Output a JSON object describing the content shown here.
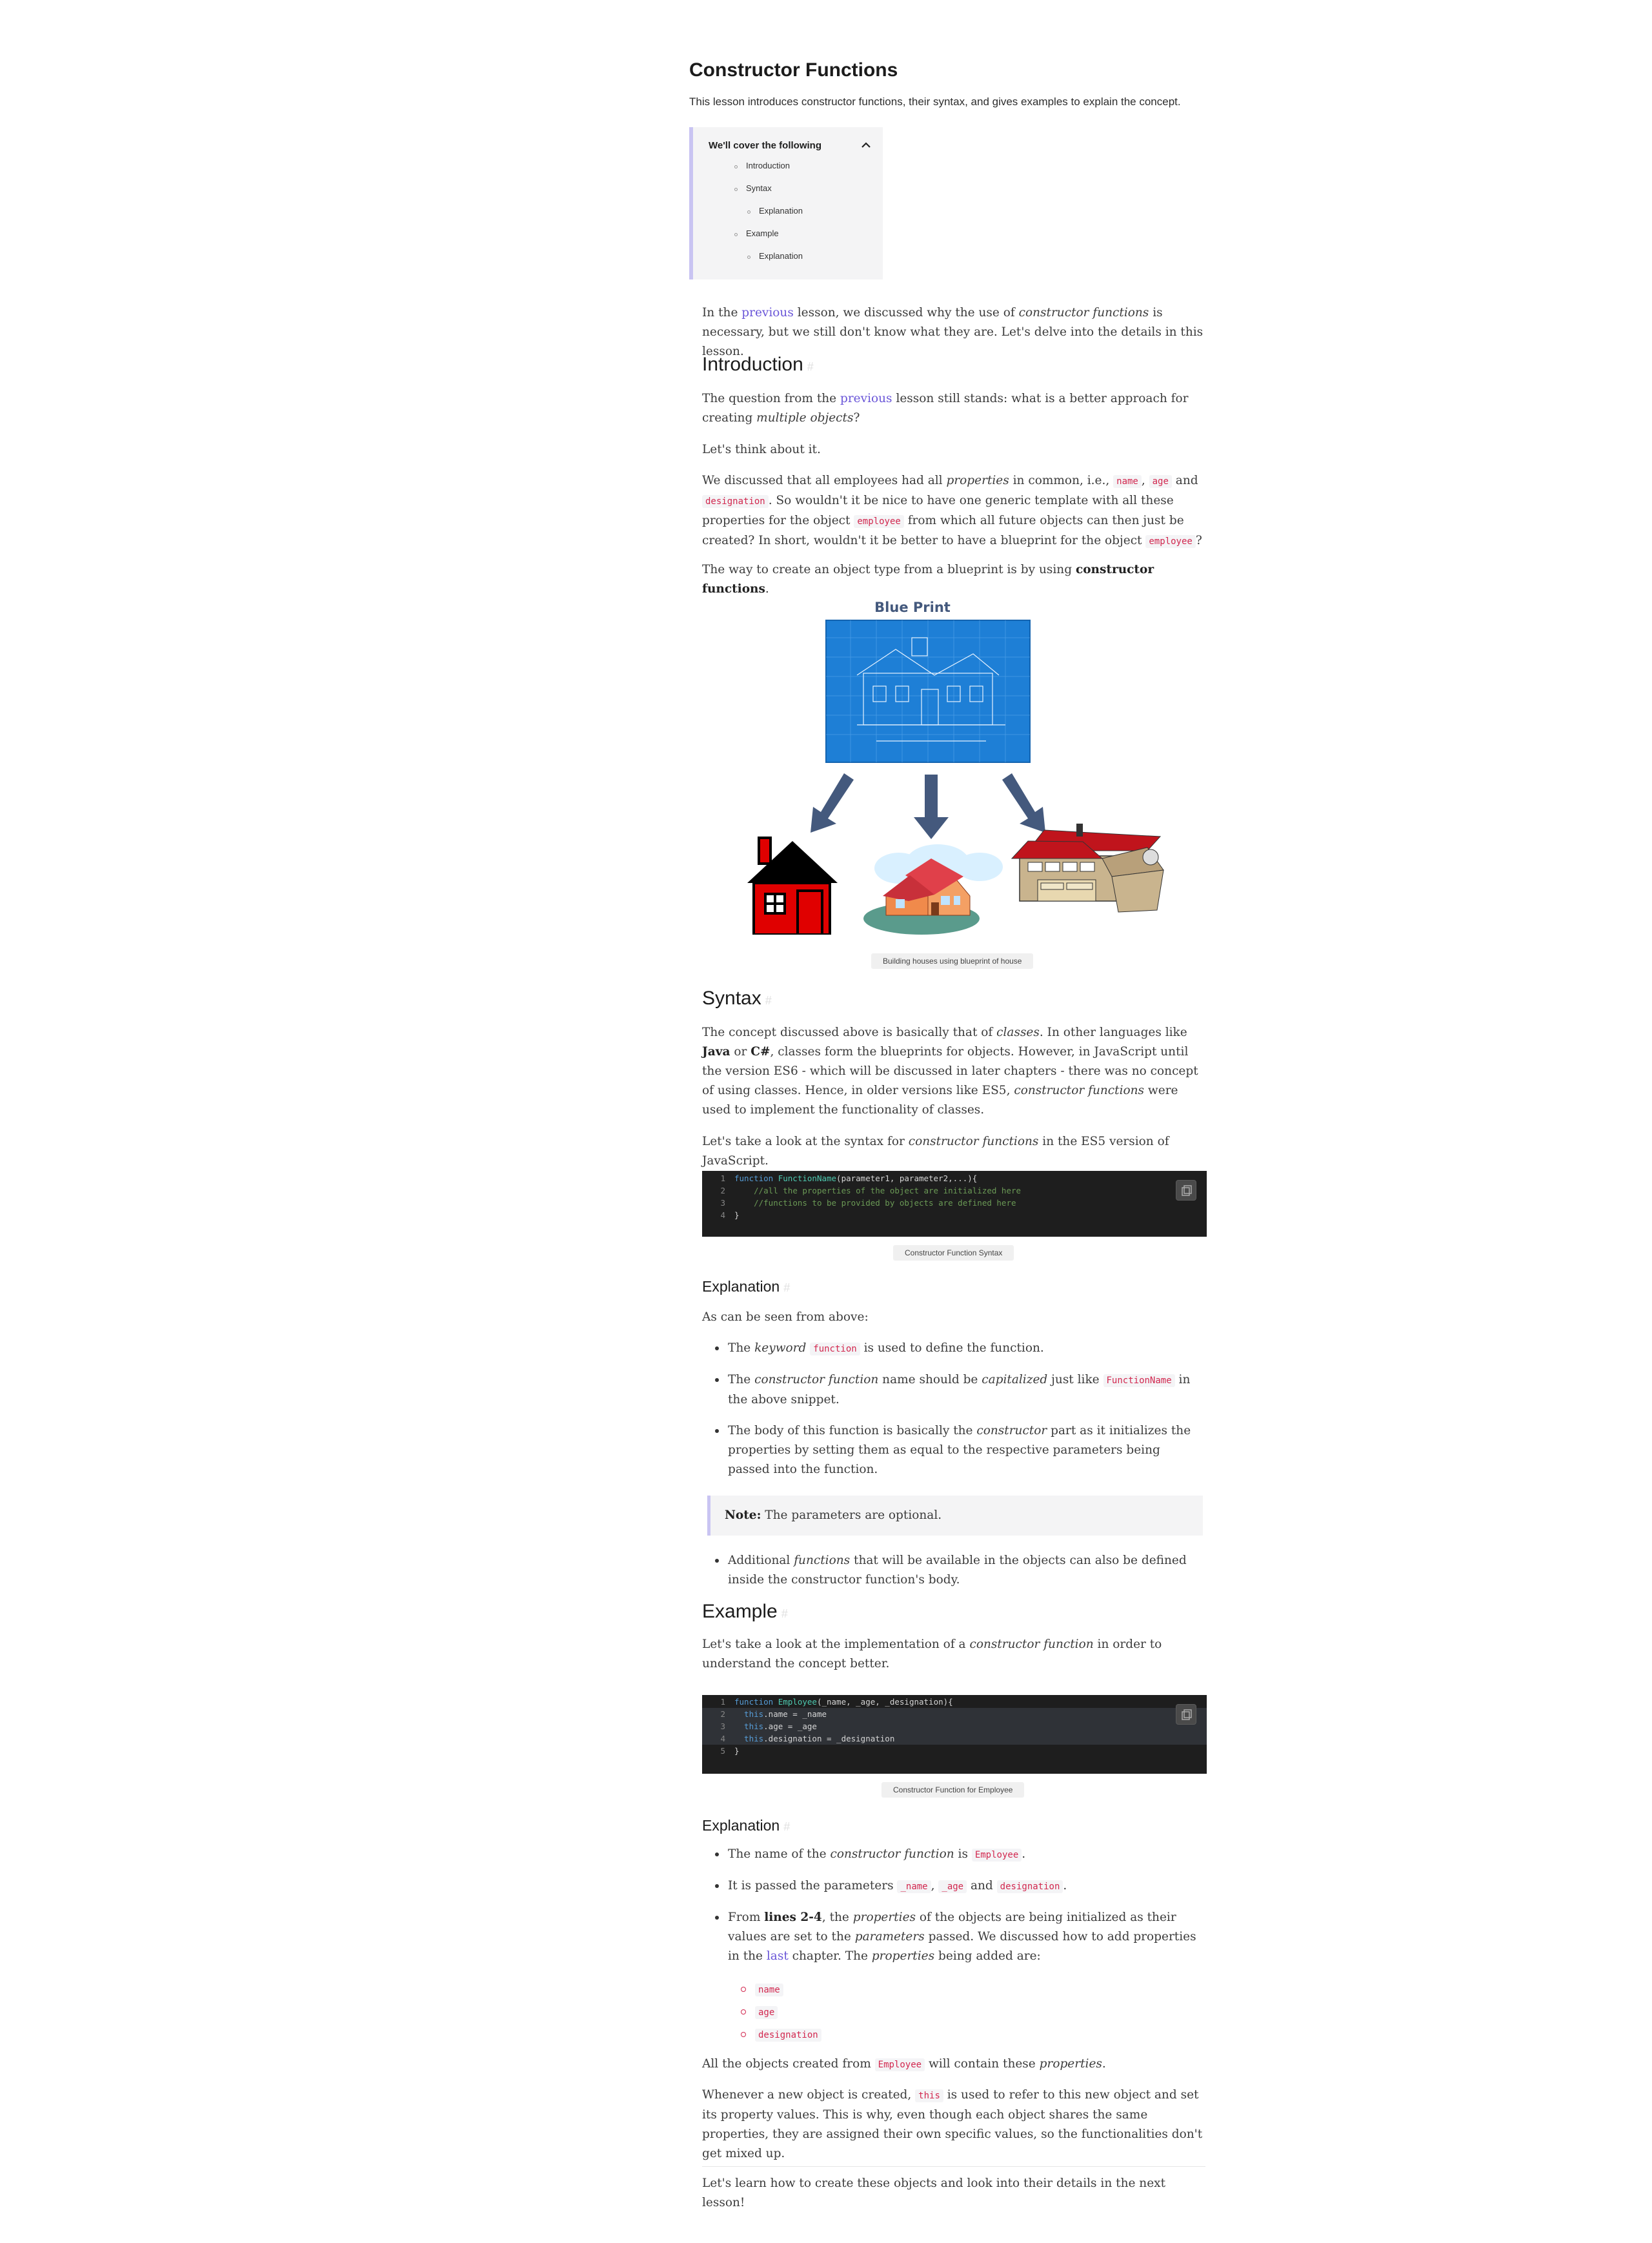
{
  "header": {
    "title": "Constructor Functions",
    "subtitle": "This lesson introduces constructor functions, their syntax, and gives examples to explain the concept."
  },
  "toc": {
    "heading": "We'll cover the following",
    "items": [
      {
        "label": "Introduction",
        "level": 1
      },
      {
        "label": "Syntax",
        "level": 1
      },
      {
        "label": "Explanation",
        "level": 2
      },
      {
        "label": "Example",
        "level": 1
      },
      {
        "label": "Explanation",
        "level": 2
      }
    ]
  },
  "intro": {
    "p1_a": "In the ",
    "p1_link": "previous",
    "p1_b": " lesson, we discussed why the use of ",
    "p1_em": "constructor functions",
    "p1_c": " is necessary, but we still don't know what they are. Let's delve into the details in this lesson."
  },
  "introduction": {
    "heading": "Introduction",
    "p1_a": "The question from the ",
    "p1_link": "previous",
    "p1_b": " lesson still stands: what is a better approach for creating ",
    "p1_em": "multiple objects",
    "p1_c": "?",
    "p2": "Let's think about it.",
    "p3_a": "We discussed that all employees had all ",
    "p3_em": "properties",
    "p3_b": " in common, i.e., ",
    "p3_code1": "name",
    "p3_c": ", ",
    "p3_code2": "age",
    "p3_d": " and ",
    "p3_code3": "designation",
    "p3_e": ". So wouldn't it be nice to have one generic template with all these properties for the object ",
    "p3_code4": "employee",
    "p3_f": " from which all future objects can then just be created? In short, wouldn't it be better to have a blueprint for the object ",
    "p3_code5": "employee",
    "p3_g": "?",
    "p4_a": "The way to create an object type from a blueprint is by using ",
    "p4_b": "constructor functions",
    "p4_c": "."
  },
  "figure": {
    "label": "Blue Print",
    "caption": "Building houses using blueprint of house",
    "colors": {
      "blueprint": "#1e7fd6",
      "arrow": "#44597d",
      "roof": "#c0141c",
      "house_red": "#e00000"
    }
  },
  "syntax": {
    "heading": "Syntax",
    "p1_a": "The concept discussed above is basically that of ",
    "p1_em": "classes",
    "p1_b": ". In other languages like ",
    "p1_b1": "Java",
    "p1_c": " or ",
    "p1_b2": "C#",
    "p1_d": ", classes form the blueprints for objects. However, in JavaScript until the version ES6 - which will be discussed in later chapters - there was no concept of using classes. Hence, in older versions like ES5, ",
    "p1_em2": "constructor functions",
    "p1_e": " were used to implement the functionality of classes.",
    "p2_a": "Let's take a look at the syntax for ",
    "p2_em": "constructor functions",
    "p2_b": " in the ES5 version of JavaScript.",
    "code": {
      "lines": [
        {
          "n": "1",
          "kw": "function ",
          "fn": "FunctionName",
          "rest": "(parameter1, parameter2,...){",
          "cm": ""
        },
        {
          "n": "2",
          "kw": "",
          "fn": "",
          "rest": "    ",
          "cm": "//all the properties of the object are initialized here"
        },
        {
          "n": "3",
          "kw": "",
          "fn": "",
          "rest": "    ",
          "cm": "//functions to be provided by objects are defined here"
        },
        {
          "n": "4",
          "kw": "",
          "fn": "",
          "rest": "}",
          "cm": ""
        }
      ],
      "caption": "Constructor Function Syntax"
    }
  },
  "explanation1": {
    "heading": "Explanation",
    "p1": "As can be seen from above:",
    "li1_a": "The ",
    "li1_em": "keyword",
    "li1_code": "function",
    "li1_b": " is used to define the function.",
    "li2_a": "The ",
    "li2_em": "constructor function",
    "li2_b": " name should be ",
    "li2_em2": "capitalized",
    "li2_c": " just like ",
    "li2_code": "FunctionName",
    "li2_d": " in the above snippet.",
    "li3_a": "The body of this function is basically the ",
    "li3_em": "constructor",
    "li3_b": " part as it initializes the properties by setting them as equal to the respective parameters being passed into the function.",
    "note_label": "Note:",
    "note_text": " The parameters are optional.",
    "li4_a": "Additional ",
    "li4_em": "functions",
    "li4_b": " that will be available in the objects can also be defined inside the constructor function's body."
  },
  "example": {
    "heading": "Example",
    "p1_a": "Let's take a look at the implementation of a ",
    "p1_em": "constructor function",
    "p1_b": " in order to understand the concept better.",
    "code": {
      "lines": [
        {
          "n": "1",
          "kw": "function ",
          "fn": "Employee",
          "rest": "(_name, _age, _designation){",
          "hl": false
        },
        {
          "n": "2",
          "kw": "  this",
          "fn": "",
          "rest": ".name = _name",
          "hl": true
        },
        {
          "n": "3",
          "kw": "  this",
          "fn": "",
          "rest": ".age = _age",
          "hl": true
        },
        {
          "n": "4",
          "kw": "  this",
          "fn": "",
          "rest": ".designation = _designation",
          "hl": true
        },
        {
          "n": "5",
          "kw": "",
          "fn": "",
          "rest": "}",
          "hl": false
        }
      ],
      "caption": "Constructor Function for Employee"
    }
  },
  "explanation2": {
    "heading": "Explanation",
    "li1_a": "The name of the ",
    "li1_em": "constructor function",
    "li1_b": " is ",
    "li1_code": "Employee",
    "li1_c": ".",
    "li2_a": "It is passed the parameters ",
    "li2_code1": "_name",
    "li2_b": ", ",
    "li2_code2": "_age",
    "li2_c": " and ",
    "li2_code3": "designation",
    "li2_d": ".",
    "li3_a": "From ",
    "li3_b": "lines 2-4",
    "li3_c": ", the ",
    "li3_em": "properties",
    "li3_d": " of the objects are being initialized as their values are set to the ",
    "li3_em2": "parameters",
    "li3_e": " passed. We discussed how to add properties in the ",
    "li3_link": "last",
    "li3_f": " chapter. The ",
    "li3_em3": "properties",
    "li3_g": " being added are:",
    "sub": [
      "name",
      "age",
      "designation"
    ],
    "p1_a": "All the objects created from ",
    "p1_code": "Employee",
    "p1_b": " will contain these ",
    "p1_em": "properties",
    "p1_c": ".",
    "p2_a": "Whenever a new object is created, ",
    "p2_code": "this",
    "p2_b": " is used to refer to this new object and set its property values. This is why, even though each object shares the same properties, they are assigned their own specific values, so the functionalities don't get mixed up."
  },
  "footer": {
    "text": "Let's learn how to create these objects and look into their details in the next lesson!"
  }
}
